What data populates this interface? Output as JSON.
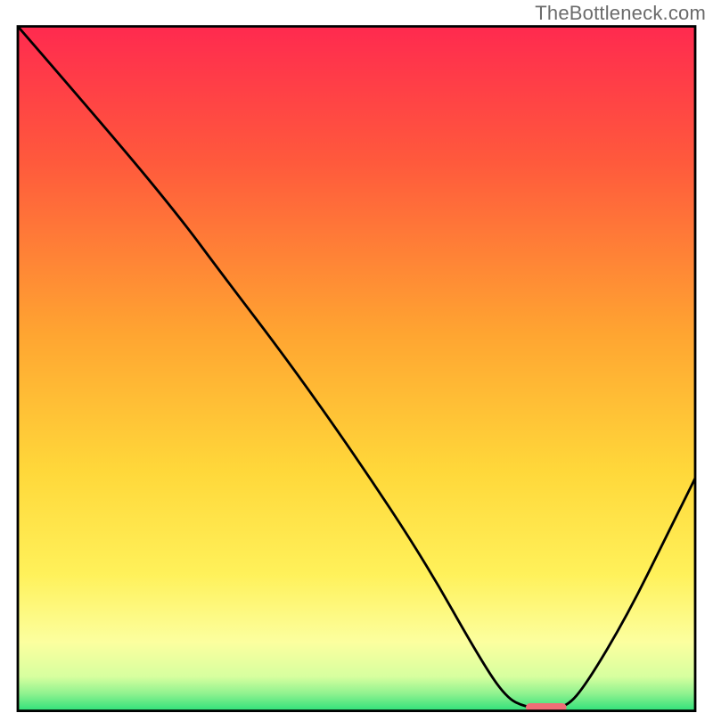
{
  "watermark": "TheBottleneck.com",
  "chart_data": {
    "type": "line",
    "title": "",
    "xlabel": "",
    "ylabel": "",
    "xlim": [
      0,
      100
    ],
    "ylim": [
      0,
      100
    ],
    "grid": false,
    "legend": false,
    "gradient_stops": [
      {
        "offset": 0.0,
        "color": "#ff2a4f"
      },
      {
        "offset": 0.2,
        "color": "#ff5a3c"
      },
      {
        "offset": 0.45,
        "color": "#ffa531"
      },
      {
        "offset": 0.65,
        "color": "#ffd83a"
      },
      {
        "offset": 0.8,
        "color": "#fff15a"
      },
      {
        "offset": 0.9,
        "color": "#fcff9f"
      },
      {
        "offset": 0.95,
        "color": "#d7ff9f"
      },
      {
        "offset": 0.975,
        "color": "#8ff28f"
      },
      {
        "offset": 1.0,
        "color": "#2fe07a"
      }
    ],
    "curve": [
      {
        "x": 0,
        "y": 100
      },
      {
        "x": 14,
        "y": 84
      },
      {
        "x": 24,
        "y": 72
      },
      {
        "x": 30,
        "y": 64
      },
      {
        "x": 40,
        "y": 51
      },
      {
        "x": 50,
        "y": 37
      },
      {
        "x": 60,
        "y": 22
      },
      {
        "x": 68,
        "y": 8
      },
      {
        "x": 72,
        "y": 2
      },
      {
        "x": 75,
        "y": 0.5
      },
      {
        "x": 78,
        "y": 0.5
      },
      {
        "x": 81,
        "y": 0.5
      },
      {
        "x": 84,
        "y": 4
      },
      {
        "x": 90,
        "y": 14
      },
      {
        "x": 96,
        "y": 26
      },
      {
        "x": 100,
        "y": 34
      }
    ],
    "marker": {
      "x_start": 75,
      "x_end": 81,
      "y": 0.5,
      "color": "#ef6e76"
    },
    "frame": {
      "x": 2.5,
      "y": 3.7,
      "width": 95,
      "height": 96,
      "stroke": "#000000",
      "stroke_width": 0.35
    }
  }
}
